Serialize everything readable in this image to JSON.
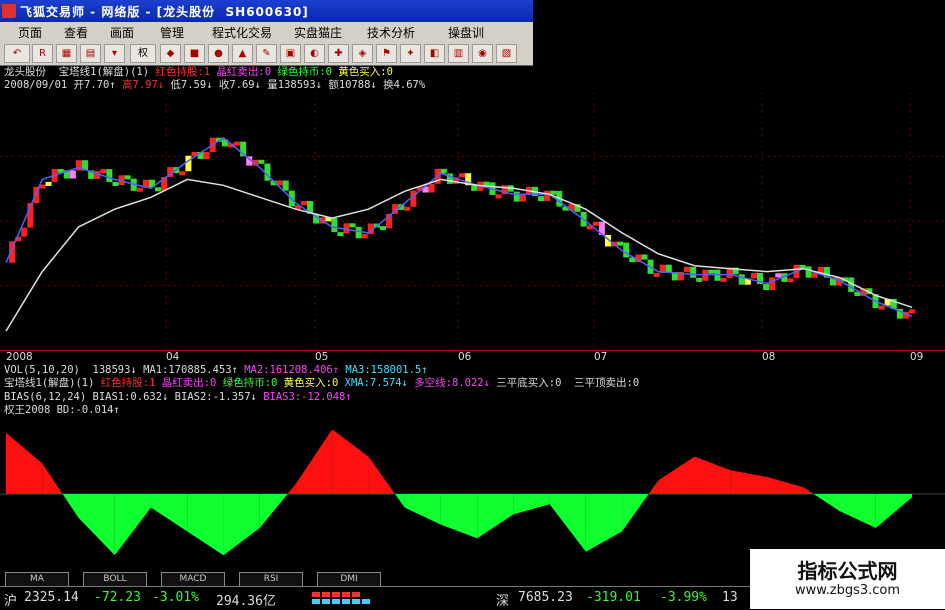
{
  "window": {
    "title": "飞狐交易师 - 网络版 - [龙头股份  SH600630]"
  },
  "menu": [
    "页面",
    "查看",
    "画面",
    "管理",
    "程式化交易",
    "实盘猫庄",
    "技术分析",
    "操盘训"
  ],
  "toolbar": {
    "buttons": [
      "back",
      "rsi",
      "chart",
      "book",
      "dropdown",
      "rights",
      "f1",
      "f2",
      "f3",
      "f4",
      "f5",
      "f6",
      "f7",
      "f8",
      "f9",
      "f10",
      "f11",
      "f12",
      "f13",
      "f14",
      "f15"
    ],
    "rights_label": "权"
  },
  "main_header": {
    "line1": [
      {
        "t": "龙头股份  宝塔线1(解盘)(1) ",
        "c": "w"
      },
      {
        "t": "红色持股:1 ",
        "c": "r"
      },
      {
        "t": "晶红卖出:0 ",
        "c": "m"
      },
      {
        "t": "绿色持币:0 ",
        "c": "g"
      },
      {
        "t": "黄色买入:0",
        "c": "y"
      }
    ],
    "line2": [
      {
        "t": "2008/09/01 开7.70↑ ",
        "c": "w"
      },
      {
        "t": "高7.97↓ ",
        "c": "r"
      },
      {
        "t": "低7.59↓ 收7.69↓ 量138593↓ 额10788↓ 换4.67%",
        "c": "w"
      }
    ]
  },
  "dates": [
    "2008",
    "04",
    "05",
    "06",
    "07",
    "08",
    "09"
  ],
  "indicators": {
    "vol": [
      {
        "t": "VOL(5,10,20)  138593↓ ",
        "c": "w"
      },
      {
        "t": "MA1:170885.453↑ ",
        "c": "w"
      },
      {
        "t": "MA2:161208.406↑ ",
        "c": "m"
      },
      {
        "t": "MA3:158001.5↑",
        "c": "c"
      }
    ],
    "tower": [
      {
        "t": "宝塔线1(解盘)(1) ",
        "c": "w"
      },
      {
        "t": "红色持股:1 ",
        "c": "r"
      },
      {
        "t": "晶红卖出:0 ",
        "c": "m"
      },
      {
        "t": "绿色持币:0 ",
        "c": "g"
      },
      {
        "t": "黄色买入:0 ",
        "c": "y"
      },
      {
        "t": "XMA:7.574↓ ",
        "c": "c"
      },
      {
        "t": "多空线:8.022↓ ",
        "c": "m"
      },
      {
        "t": "三平底买入:0  三平顶卖出:0",
        "c": "w"
      }
    ],
    "bias": [
      {
        "t": "BIAS(6,12,24) BIAS1:0.632↓ BIAS2:-1.357↓ ",
        "c": "w"
      },
      {
        "t": "BIAS3:-12.048↑",
        "c": "m"
      }
    ],
    "quan": [
      {
        "t": "权王2008 BD:-0.014↑",
        "c": "w"
      }
    ]
  },
  "bottom_tabs": [
    "MA",
    "BOLL",
    "MACD",
    "RSI",
    "DMI"
  ],
  "status": {
    "sh_label": "沪",
    "sh_index": "2325.14",
    "sh_change": "-72.23",
    "sh_pct": "-3.01%",
    "sh_amount": "294.36亿",
    "sz_label": "深",
    "sz_index": "7685.23",
    "sz_change": "-319.01",
    "sz_pct": "-3.99%",
    "sz_extra": "13"
  },
  "watermark": {
    "line1": "指标公式网",
    "line2": "www.zbgs3.com"
  },
  "colors": {
    "up": "#ff2020",
    "down": "#30e030",
    "buy": "#ffff40",
    "sell": "#ff80ff",
    "ma_blue": "#5060ff",
    "ma_white": "#e0e0e0",
    "osc_pos": "#ff1010",
    "osc_neg": "#10ff30"
  },
  "chart_data": [
    {
      "type": "line",
      "title": "宝塔线1(解盘)(1)",
      "series": [
        {
          "name": "XMA",
          "values": [
            7.8,
            10.6,
            11.0,
            10.6,
            10.3,
            11.2,
            12.0,
            11.0,
            9.8,
            9.0,
            8.8,
            9.8,
            10.8,
            10.4,
            10.1,
            10.1,
            9.2,
            8.2,
            7.5,
            7.4,
            7.4,
            7.1,
            7.6,
            7.2,
            6.5,
            6.0
          ]
        },
        {
          "name": "多空线",
          "values": [
            5.5,
            7.5,
            9.0,
            9.6,
            10.0,
            10.6,
            10.4,
            10.0,
            9.6,
            9.3,
            9.6,
            10.2,
            10.6,
            10.4,
            10.3,
            10.1,
            9.6,
            8.8,
            8.1,
            7.7,
            7.6,
            7.5,
            7.6,
            7.3,
            6.7,
            6.3
          ]
        }
      ]
    },
    {
      "type": "area",
      "title": "权王2008",
      "values": [
        0.9,
        0.45,
        -0.35,
        -0.9,
        -0.2,
        -0.55,
        -0.9,
        -0.5,
        0.15,
        0.95,
        0.55,
        -0.2,
        -0.45,
        -0.65,
        -0.3,
        -0.15,
        -0.85,
        -0.55,
        0.2,
        0.55,
        0.35,
        0.25,
        0.1,
        -0.25,
        -0.5,
        -0.05
      ]
    }
  ]
}
